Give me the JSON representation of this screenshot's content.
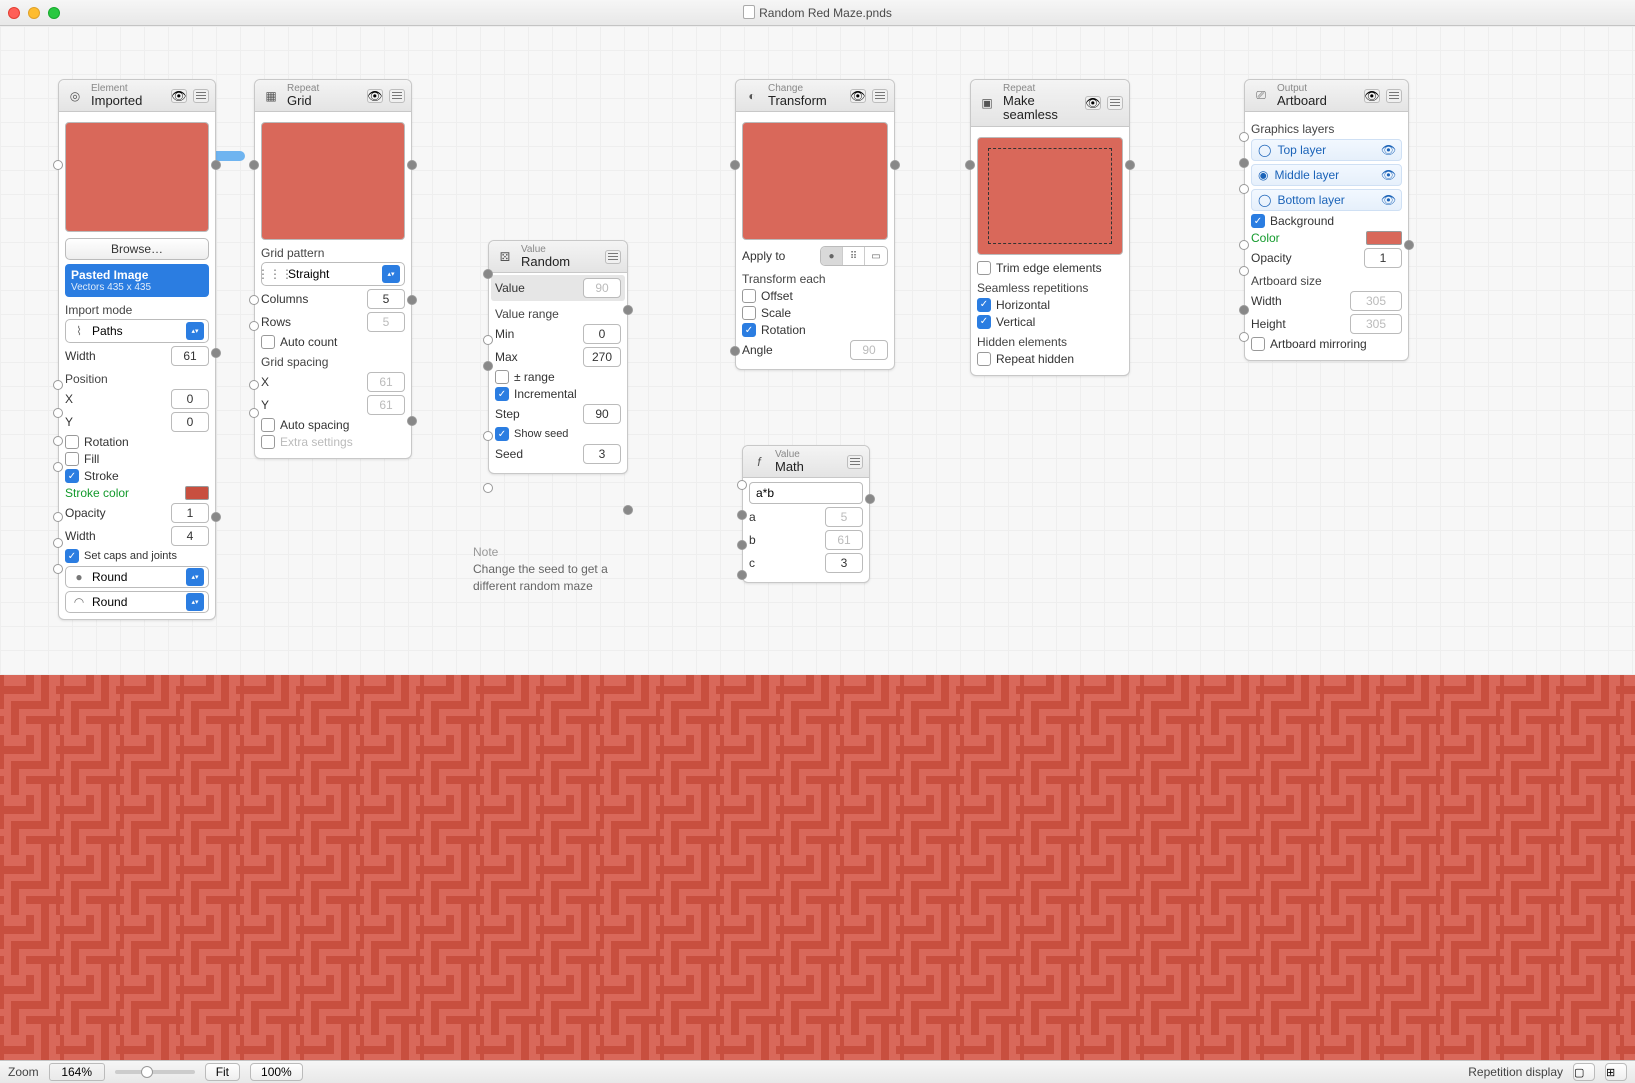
{
  "window": {
    "title": "Random Red Maze.pnds"
  },
  "colors": {
    "maze_bg": "#d9685a",
    "maze_fg": "#c84f3f",
    "accent": "#2b7de1"
  },
  "nodes": {
    "imported": {
      "category": "Element",
      "name": "Imported",
      "browse": "Browse…",
      "pasted_title": "Pasted Image",
      "pasted_sub": "Vectors 435 x 435",
      "import_mode_label": "Import mode",
      "import_mode_value": "Paths",
      "width_label": "Width",
      "width_value": "61",
      "position_label": "Position",
      "x_label": "X",
      "x_value": "0",
      "y_label": "Y",
      "y_value": "0",
      "rotation_label": "Rotation",
      "fill_label": "Fill",
      "stroke_label": "Stroke",
      "stroke_color_label": "Stroke color",
      "opacity_label": "Opacity",
      "opacity_value": "1",
      "stroke_width_label": "Width",
      "stroke_width_value": "4",
      "caps_label": "Set caps and joints",
      "caps_value": "Round",
      "joints_value": "Round"
    },
    "grid": {
      "category": "Repeat",
      "name": "Grid",
      "pattern_label": "Grid pattern",
      "pattern_value": "Straight",
      "columns_label": "Columns",
      "columns_value": "5",
      "rows_label": "Rows",
      "rows_value": "5",
      "autocount_label": "Auto count",
      "spacing_label": "Grid spacing",
      "sx_label": "X",
      "sx_value": "61",
      "sy_label": "Y",
      "sy_value": "61",
      "autospacing_label": "Auto spacing",
      "extra_label": "Extra settings"
    },
    "random": {
      "category": "Value",
      "name": "Random",
      "value_label": "Value",
      "value_value": "90",
      "range_label": "Value range",
      "min_label": "Min",
      "min_value": "0",
      "max_label": "Max",
      "max_value": "270",
      "pmrange_label": "± range",
      "incremental_label": "Incremental",
      "step_label": "Step",
      "step_value": "90",
      "showseed_label": "Show seed",
      "seed_label": "Seed",
      "seed_value": "3"
    },
    "transform": {
      "category": "Change",
      "name": "Transform",
      "applyto_label": "Apply to",
      "each_label": "Transform each",
      "offset_label": "Offset",
      "scale_label": "Scale",
      "rotation_label": "Rotation",
      "angle_label": "Angle",
      "angle_value": "90"
    },
    "seamless": {
      "category": "Repeat",
      "name": "Make seamless",
      "trim_label": "Trim edge elements",
      "reps_label": "Seamless repetitions",
      "horiz_label": "Horizontal",
      "vert_label": "Vertical",
      "hidden_label": "Hidden elements",
      "repeat_hidden_label": "Repeat hidden"
    },
    "math": {
      "category": "Value",
      "name": "Math",
      "expr": "a*b",
      "a_label": "a",
      "a_value": "5",
      "b_label": "b",
      "b_value": "61",
      "c_label": "c",
      "c_value": "3"
    },
    "artboard": {
      "category": "Output",
      "name": "Artboard",
      "layers_label": "Graphics layers",
      "top": "Top layer",
      "mid": "Middle layer",
      "bot": "Bottom layer",
      "bg_label": "Background",
      "color_label": "Color",
      "opacity_label": "Opacity",
      "opacity_value": "1",
      "size_label": "Artboard size",
      "w_label": "Width",
      "w_value": "305",
      "h_label": "Height",
      "h_value": "305",
      "mirror_label": "Artboard mirroring"
    }
  },
  "note": {
    "heading": "Note",
    "line1": "Change the seed to get a",
    "line2": "different random maze"
  },
  "footer": {
    "zoom_label": "Zoom",
    "zoom_value": "164%",
    "fit": "Fit",
    "hundred": "100%",
    "rep": "Repetition display"
  }
}
